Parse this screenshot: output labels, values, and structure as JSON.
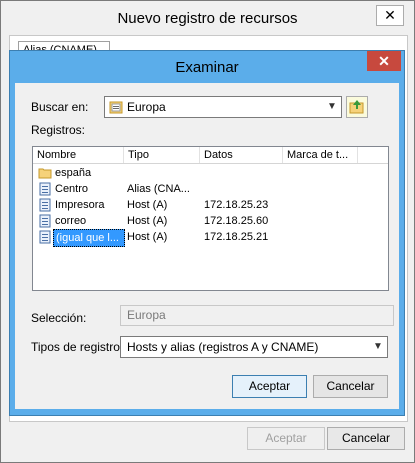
{
  "outer_dialog": {
    "title": "Nuevo registro de recursos",
    "close_glyph": "✕",
    "tab_label": "Alias (CNAME)",
    "accept_label": "Aceptar",
    "cancel_label": "Cancelar"
  },
  "browse_dialog": {
    "title": "Examinar",
    "close_glyph": "✕",
    "look_in_label": "Buscar en:",
    "look_in_value": "Europa",
    "records_label": "Registros:",
    "columns": [
      "Nombre",
      "Tipo",
      "Datos",
      "Marca de t..."
    ],
    "rows": [
      {
        "icon": "folder-icon",
        "name": "españa",
        "type": "",
        "data": "",
        "selected": false
      },
      {
        "icon": "record-icon",
        "name": "Centro",
        "type": "Alias (CNA...",
        "data": "",
        "selected": false
      },
      {
        "icon": "record-icon",
        "name": "Impresora",
        "type": "Host (A)",
        "data": "172.18.25.23",
        "selected": false
      },
      {
        "icon": "record-icon",
        "name": "correo",
        "type": "Host (A)",
        "data": "172.18.25.60",
        "selected": false
      },
      {
        "icon": "record-icon",
        "name": "(igual que l...",
        "type": "Host (A)",
        "data": "172.18.25.21",
        "selected": true
      }
    ],
    "selection_label": "Selección:",
    "selection_value": "Europa",
    "record_types_label": "Tipos de registro:",
    "record_types_value": "Hosts y alias (registros A y CNAME)",
    "accept_label": "Aceptar",
    "cancel_label": "Cancelar"
  },
  "colors": {
    "accent_blue": "#5badea",
    "close_red": "#c7493e",
    "selection_blue": "#3399ff"
  }
}
